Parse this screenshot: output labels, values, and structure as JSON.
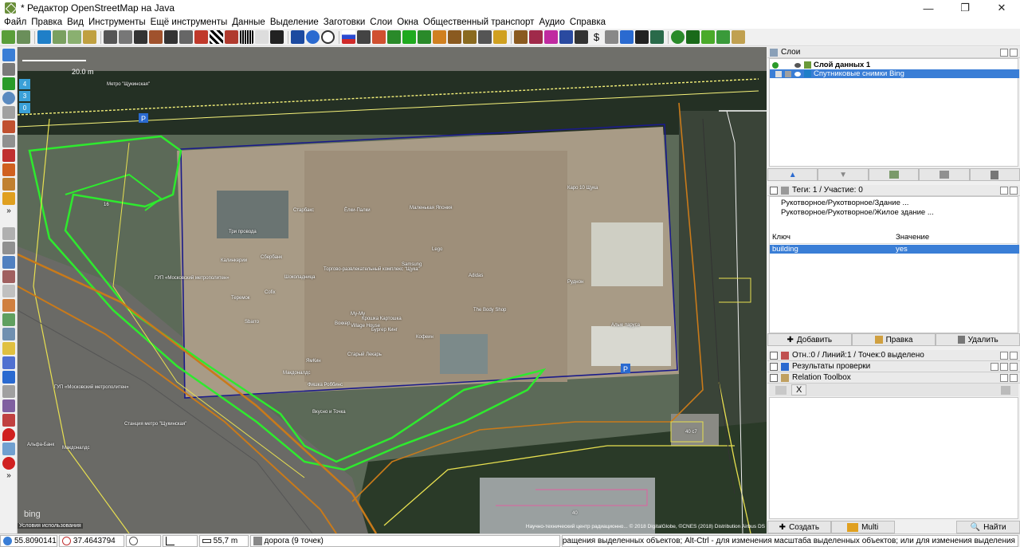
{
  "window": {
    "title": "* Редактор OpenStreetMap на Java",
    "minimize": "—",
    "maximize": "❐",
    "close": "✕"
  },
  "menu": [
    "Файл",
    "Правка",
    "Вид",
    "Инструменты",
    "Ещё инструменты",
    "Данные",
    "Выделение",
    "Заготовки",
    "Слои",
    "Окна",
    "Общественный транспорт",
    "Аудио",
    "Справка"
  ],
  "map": {
    "scale_label": "20.0 m",
    "zoom_levels": [
      "4",
      "3",
      "0"
    ],
    "bing_logo": "bing",
    "terms": "Условия использования",
    "attribution": "Научно-технический центр радиационно... © 2018 DigitalGlobe, ©CNES (2018) Distribution Airbus DS",
    "labels": [
      {
        "id": "metro-schukinskaya",
        "text": "Метро \"Щукинская\""
      },
      {
        "id": "starbucks",
        "text": "Старбакс"
      },
      {
        "id": "elki-palki",
        "text": "Ёлки-Палки"
      },
      {
        "id": "malenkaya-yaponiya",
        "text": "Маленькая Япония"
      },
      {
        "id": "karo",
        "text": "Каро 10 Щука"
      },
      {
        "id": "tri-provoda",
        "text": "Три провода"
      },
      {
        "id": "sberbank",
        "text": "Сбербанк"
      },
      {
        "id": "kalinka",
        "text": "Калинкерии"
      },
      {
        "id": "shokoladnitsa",
        "text": "Шоколадница"
      },
      {
        "id": "trc-schuka",
        "text": "Торгово-развлекательный комплекс \"Щука\""
      },
      {
        "id": "samsung",
        "text": "Samsung"
      },
      {
        "id": "lego",
        "text": "Lego"
      },
      {
        "id": "adidas",
        "text": "Adidas"
      },
      {
        "id": "rudnik",
        "text": "Руднон"
      },
      {
        "id": "gup-metro",
        "text": "ГУП «Московский метрополитен»"
      },
      {
        "id": "teremok",
        "text": "Теремок"
      },
      {
        "id": "cofix",
        "text": "Cofix"
      },
      {
        "id": "mu-mu",
        "text": "Му-Му"
      },
      {
        "id": "kroshka-kartoshka",
        "text": "Крошка Картошка"
      },
      {
        "id": "body-shop",
        "text": "The Body Shop"
      },
      {
        "id": "alye-parusa",
        "text": "Алые паруса"
      },
      {
        "id": "sbarro",
        "text": "Sbarro"
      },
      {
        "id": "vokker",
        "text": "Воккер"
      },
      {
        "id": "village-house",
        "text": "Village House"
      },
      {
        "id": "burger-king",
        "text": "Бургер Кинг"
      },
      {
        "id": "kofein",
        "text": "Кофеин"
      },
      {
        "id": "stary-lekar",
        "text": "Старый Лекарь"
      },
      {
        "id": "yamkin",
        "text": "ЯмКин"
      },
      {
        "id": "mcdonalds",
        "text": "Макдоналдс"
      },
      {
        "id": "fishka",
        "text": "Фишка Роббинс"
      },
      {
        "id": "gup-metro-2",
        "text": "ГУП «Московский метрополитен»"
      },
      {
        "id": "vkusno",
        "text": "Вкусно и Точка"
      },
      {
        "id": "stantsiya",
        "text": "Станция метро \"Щукинская\""
      },
      {
        "id": "alfa-bank",
        "text": "Альфа-Банк"
      },
      {
        "id": "mcdonalds-2",
        "text": "Макдоналдс"
      },
      {
        "id": "addr-40c7",
        "text": "40 с7"
      },
      {
        "id": "addr-40",
        "text": "40"
      },
      {
        "id": "addr-16",
        "text": "16"
      }
    ]
  },
  "layers_panel": {
    "title": "Слои",
    "rows": [
      {
        "name": "Слой данных 1"
      },
      {
        "name": "Спутниковые снимки Bing"
      }
    ]
  },
  "tags_panel": {
    "title": "Теги: 1 / Участие: 0",
    "presets": [
      "Рукотворное/Рукотворное/Здание ...",
      "Рукотворное/Рукотворное/Жилое здание ..."
    ],
    "col_key": "Ключ",
    "col_value": "Значение",
    "rows": [
      {
        "key": "building",
        "value": "yes"
      }
    ],
    "btn_add": "Добавить",
    "btn_edit": "Правка",
    "btn_delete": "Удалить"
  },
  "selection_panel": {
    "title": "Отн.:0 / Линий:1 / Точек:0 выделено"
  },
  "validation_panel": {
    "title": "Результаты проверки"
  },
  "relation_panel": {
    "title": "Relation Toolbox",
    "tab_x": "X",
    "btn_create": "Создать",
    "btn_multi": "Multi",
    "btn_find": "Найти"
  },
  "status": {
    "lat": "55.8090141",
    "lon": "37.4643794",
    "distance": "55,7 m",
    "way": "дорога (9 точек)",
    "help": "ия); Shift-Ctrl - для вращения выделенных объектов; Alt-Ctrl - для изменения масштаба выделенных объектов; или для изменения выделения"
  },
  "colors": {
    "accent": "#3a7ed6",
    "osm_green": "#2eea2e",
    "building_outline": "#1a1a8a",
    "path_orange": "#c97a1a"
  }
}
